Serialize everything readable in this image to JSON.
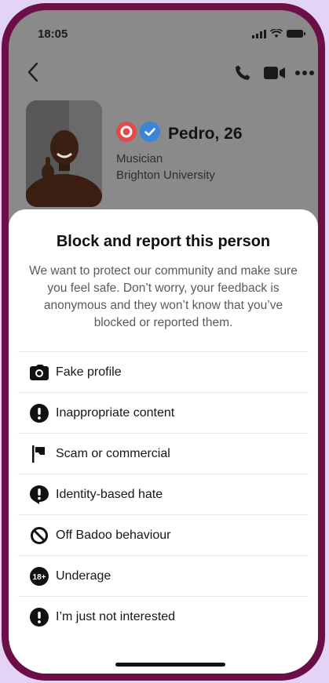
{
  "status": {
    "time": "18:05"
  },
  "profile": {
    "name_age": "Pedro, 26",
    "occupation": "Musician",
    "school": "Brighton University"
  },
  "sheet": {
    "title": "Block and report this person",
    "description": "We want to protect our community and make sure you feel safe. Don’t worry, your feedback is anonymous and they won’t know that you’ve blocked or reported them.",
    "options": [
      {
        "label": "Fake profile",
        "icon": "camera-icon"
      },
      {
        "label": "Inappropriate content",
        "icon": "exclamation-icon"
      },
      {
        "label": "Scam or commercial",
        "icon": "flag-icon"
      },
      {
        "label": "Identity-based hate",
        "icon": "hate-icon"
      },
      {
        "label": "Off Badoo behaviour",
        "icon": "prohibited-icon"
      },
      {
        "label": "Underage",
        "icon": "eighteen-plus-icon",
        "icon_text": "18+"
      },
      {
        "label": "I’m just not interested",
        "icon": "exclamation-icon"
      }
    ]
  },
  "colors": {
    "frame": "#6d0f47",
    "background": "#e3d4f5",
    "verified": "#3a86d6",
    "badge_red": "#e04a4a"
  }
}
